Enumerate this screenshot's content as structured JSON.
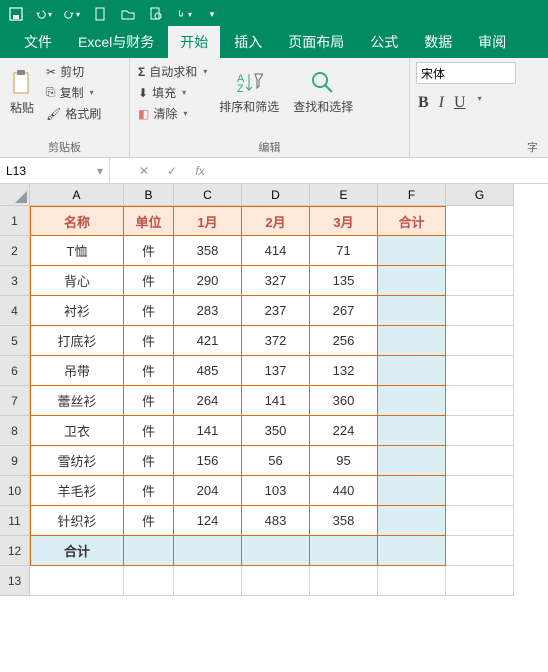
{
  "titlebar_icons": [
    "save",
    "undo",
    "redo",
    "new",
    "open",
    "preview",
    "touch"
  ],
  "tabs": [
    "文件",
    "Excel与财务",
    "开始",
    "插入",
    "页面布局",
    "公式",
    "数据",
    "审阅"
  ],
  "active_tab": 2,
  "ribbon": {
    "paste": "粘贴",
    "cut": "剪切",
    "copy": "复制",
    "format_painter": "格式刷",
    "clipboard_label": "剪贴板",
    "autosum": "自动求和",
    "fill": "填充",
    "clear": "清除",
    "sort_filter": "排序和筛选",
    "find_select": "查找和选择",
    "editing_label": "编辑",
    "font_name": "宋体",
    "font_label": "字"
  },
  "namebox": "L13",
  "columns": [
    "A",
    "B",
    "C",
    "D",
    "E",
    "F",
    "G"
  ],
  "headers": [
    "名称",
    "单位",
    "1月",
    "2月",
    "3月",
    "合计"
  ],
  "rows": [
    {
      "name": "T恤",
      "unit": "件",
      "m1": 358,
      "m2": 414,
      "m3": 71
    },
    {
      "name": "背心",
      "unit": "件",
      "m1": 290,
      "m2": 327,
      "m3": 135
    },
    {
      "name": "衬衫",
      "unit": "件",
      "m1": 283,
      "m2": 237,
      "m3": 267
    },
    {
      "name": "打底衫",
      "unit": "件",
      "m1": 421,
      "m2": 372,
      "m3": 256
    },
    {
      "name": "吊带",
      "unit": "件",
      "m1": 485,
      "m2": 137,
      "m3": 132
    },
    {
      "name": "蕾丝衫",
      "unit": "件",
      "m1": 264,
      "m2": 141,
      "m3": 360
    },
    {
      "name": "卫衣",
      "unit": "件",
      "m1": 141,
      "m2": 350,
      "m3": 224
    },
    {
      "name": "雪纺衫",
      "unit": "件",
      "m1": 156,
      "m2": 56,
      "m3": 95
    },
    {
      "name": "羊毛衫",
      "unit": "件",
      "m1": 204,
      "m2": 103,
      "m3": 440
    },
    {
      "name": "针织衫",
      "unit": "件",
      "m1": 124,
      "m2": 483,
      "m3": 358
    }
  ],
  "total_label": "合计"
}
